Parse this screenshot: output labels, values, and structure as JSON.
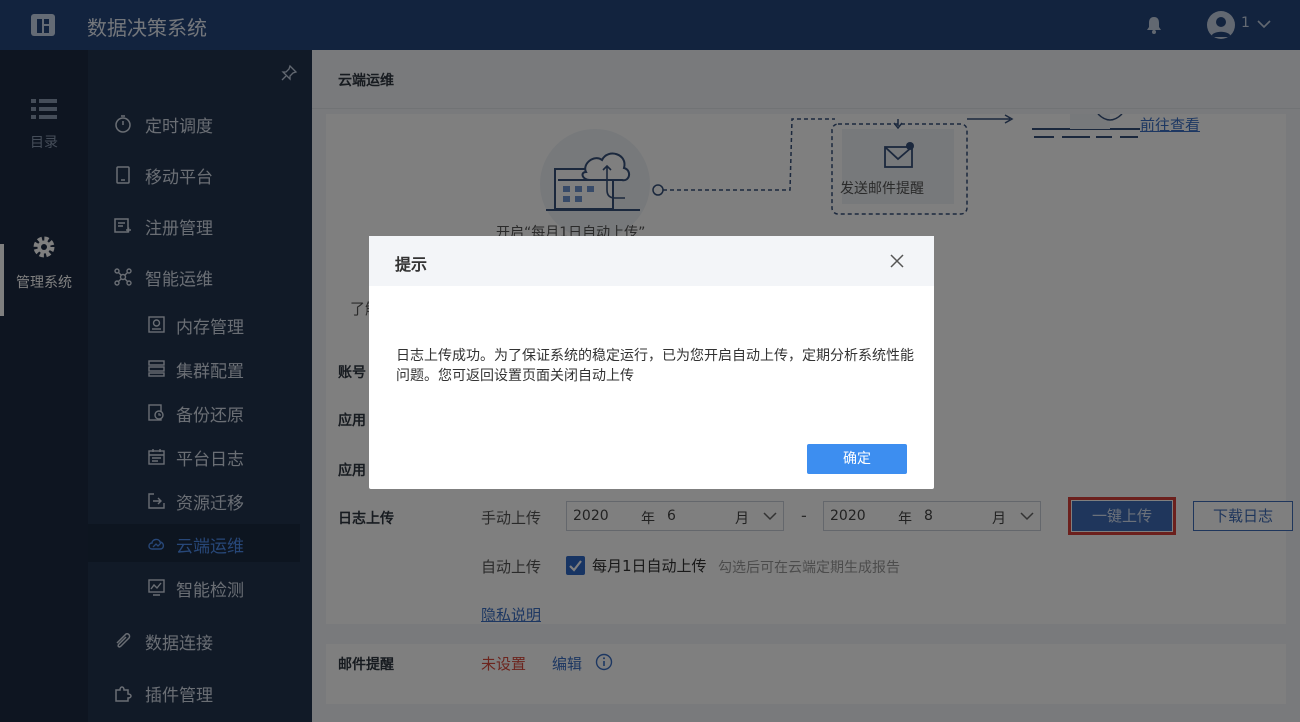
{
  "header": {
    "app_title": "数据决策系统",
    "user_name": "1",
    "brand_color": "#24467c"
  },
  "rail": {
    "items": [
      {
        "label": "目录",
        "icon": "list-icon"
      },
      {
        "label": "管理系统",
        "icon": "gear-icon"
      }
    ]
  },
  "sidebar": {
    "items": [
      {
        "label": "定时调度",
        "icon": "timer-icon"
      },
      {
        "label": "移动平台",
        "icon": "tablet-icon"
      },
      {
        "label": "注册管理",
        "icon": "register-icon"
      },
      {
        "label": "智能运维",
        "icon": "network-icon"
      },
      {
        "label": "内存管理",
        "icon": "memory-icon"
      },
      {
        "label": "集群配置",
        "icon": "cluster-icon"
      },
      {
        "label": "备份还原",
        "icon": "backup-icon"
      },
      {
        "label": "平台日志",
        "icon": "calendar-icon"
      },
      {
        "label": "资源迁移",
        "icon": "migrate-icon"
      },
      {
        "label": "云端运维",
        "icon": "cloud-chart-icon"
      },
      {
        "label": "智能检测",
        "icon": "monitor-icon"
      },
      {
        "label": "数据连接",
        "icon": "paperclip-icon"
      },
      {
        "label": "插件管理",
        "icon": "puzzle-icon"
      }
    ],
    "active": "云端运维",
    "active_color": "#4e8ef0"
  },
  "main": {
    "breadcrumb": "云端运维",
    "diagram": {
      "step1_label": "开启“每月1日自动上传”",
      "step2_label": "发送邮件提醒",
      "view_link": "前往查看",
      "partial_left": "了解"
    },
    "rows": {
      "account_label": "账号",
      "app1_label": "应用",
      "app2_label": "应用",
      "log_upload_label": "日志上传",
      "manual_label": "手动上传",
      "start_year": "2020",
      "start_month": "6",
      "end_year": "2020",
      "end_month": "8",
      "year_unit": "年",
      "month_unit": "月",
      "range_sep": "-",
      "upload_button": "一键上传",
      "download_button": "下载日志",
      "auto_label": "自动上传",
      "auto_checkbox_label": "每月1日自动上传",
      "auto_checked": true,
      "auto_hint": "勾选后可在云端定期生成报告",
      "privacy_link": "隐私说明",
      "email_label": "邮件提醒",
      "email_status": "未设置",
      "email_edit": "编辑",
      "status_color_unset": "#d94a3d"
    }
  },
  "dialog": {
    "title": "提示",
    "message": "日志上传成功。为了保证系统的稳定运行，已为您开启自动上传，定期分析系统性能问题。您可返回设置页面关闭自动上传",
    "ok_button": "确定",
    "ok_color": "#3d8ef0"
  }
}
